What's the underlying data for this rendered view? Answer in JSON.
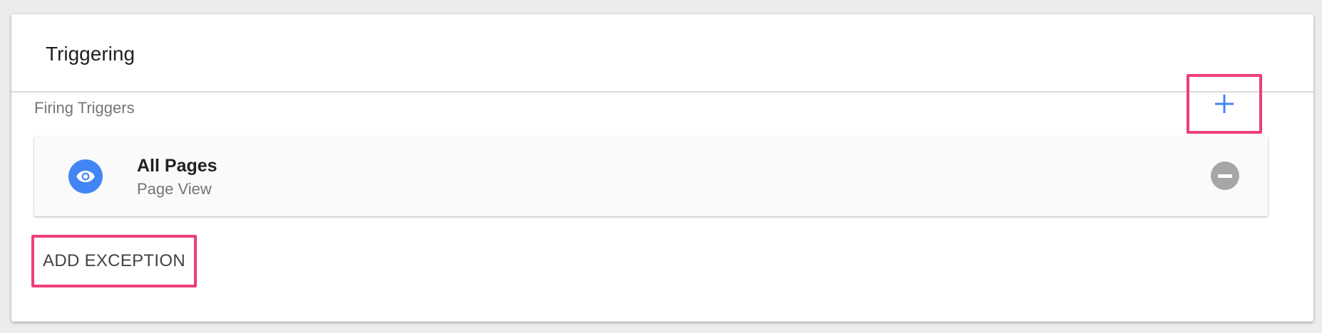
{
  "card": {
    "title": "Triggering"
  },
  "firing_triggers": {
    "label": "Firing Triggers",
    "add_icon": "plus-icon",
    "items": [
      {
        "name": "All Pages",
        "type": "Page View",
        "icon": "eye-icon",
        "icon_color": "#4285f4",
        "remove_icon": "minus-circle-icon"
      }
    ]
  },
  "exceptions": {
    "add_label": "ADD EXCEPTION"
  },
  "colors": {
    "accent_blue": "#4285f4",
    "highlight_pink": "#ee3f76"
  }
}
